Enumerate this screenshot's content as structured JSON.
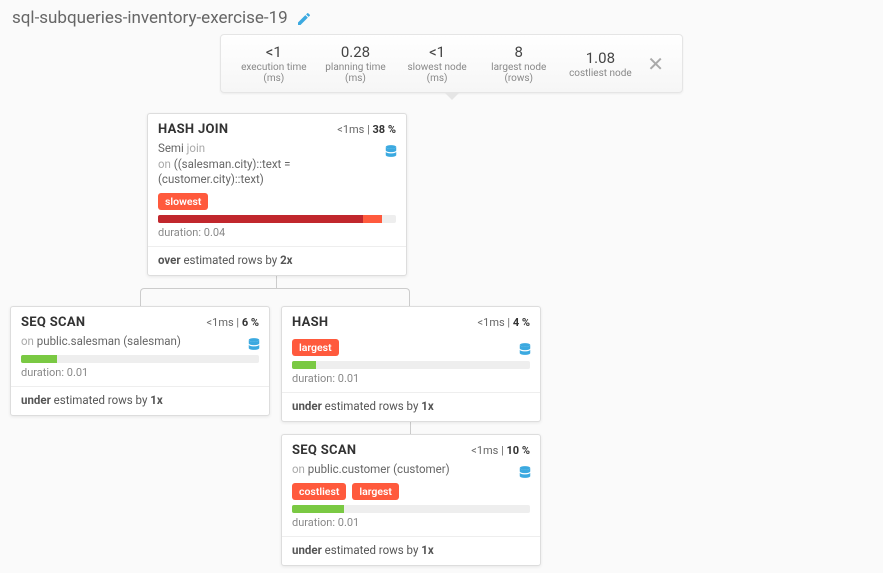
{
  "header": {
    "title": "sql-subqueries-inventory-exercise-19"
  },
  "stats": [
    {
      "value": "<1",
      "label": "execution time (ms)"
    },
    {
      "value": "0.28",
      "label": "planning time (ms)"
    },
    {
      "value": "<1",
      "label": "slowest node (ms)"
    },
    {
      "value": "8",
      "label": "largest node (rows)"
    },
    {
      "value": "1.08",
      "label": "costliest node"
    }
  ],
  "nodes": {
    "hashjoin": {
      "title": "HASH JOIN",
      "time": "<1ms",
      "pct": "38 %",
      "line1_pre": "Semi",
      "line1_grey": "join",
      "line2_grey": "on",
      "line2": "((salesman.city)::text = (customer.city)::text)",
      "tags": [
        "slowest"
      ],
      "duration": "0.04",
      "bar_pct": 86,
      "bar_color": "red",
      "bar_extra_start": 86,
      "bar_extra_width": 8,
      "est_dir": "over",
      "est_mid": "estimated rows by",
      "est_factor": "2x"
    },
    "seqscan1": {
      "title": "SEQ SCAN",
      "time": "<1ms",
      "pct": "6 %",
      "on_grey": "on",
      "on": "public.salesman (salesman)",
      "tags": [],
      "duration": "0.01",
      "bar_pct": 15,
      "bar_color": "green",
      "est_dir": "under",
      "est_mid": "estimated rows by",
      "est_factor": "1x"
    },
    "hash": {
      "title": "HASH",
      "time": "<1ms",
      "pct": "4 %",
      "tags": [
        "largest"
      ],
      "duration": "0.01",
      "bar_pct": 10,
      "bar_color": "green",
      "est_dir": "under",
      "est_mid": "estimated rows by",
      "est_factor": "1x"
    },
    "seqscan2": {
      "title": "SEQ SCAN",
      "time": "<1ms",
      "pct": "10 %",
      "on_grey": "on",
      "on": "public.customer (customer)",
      "tags": [
        "costliest",
        "largest"
      ],
      "duration": "0.01",
      "bar_pct": 22,
      "bar_color": "green",
      "est_dir": "under",
      "est_mid": "estimated rows by",
      "est_factor": "1x"
    }
  },
  "labels": {
    "duration_prefix": "duration:"
  }
}
